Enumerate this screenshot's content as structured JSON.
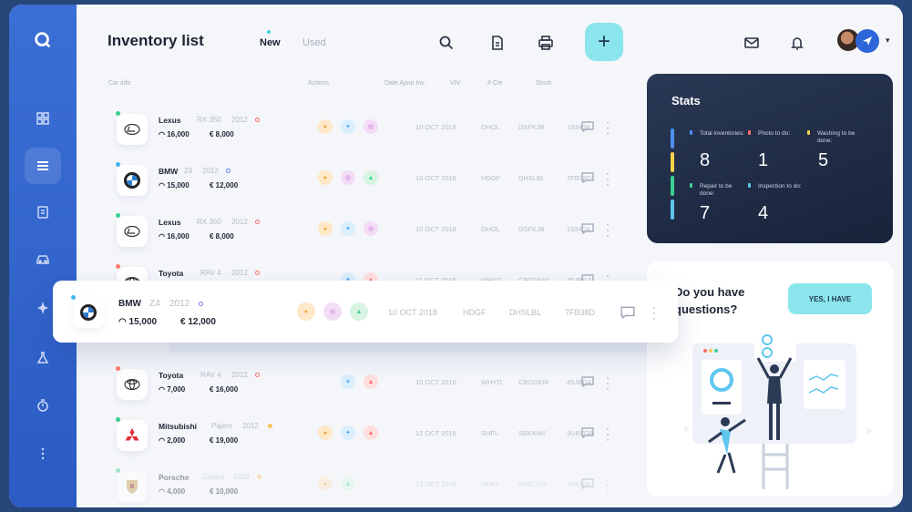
{
  "header": {
    "title": "Inventory list",
    "tabs": [
      {
        "label": "New"
      },
      {
        "label": "Used"
      }
    ],
    "tools": [
      "search-icon",
      "document-icon",
      "printer-icon",
      "mail-icon",
      "bell-icon"
    ],
    "add_label": "+"
  },
  "columns": {
    "car_info": "Car info",
    "actions": "Actions",
    "date": "Date Ajout Inv.",
    "vin": "VIV",
    "cle": "# Cle",
    "stock": "Stock"
  },
  "rows": [
    {
      "make": "Lexus",
      "model": "RX 350",
      "year": "2012",
      "km": "16,000",
      "price": "€ 8,000",
      "date": "10 OCT 2018",
      "vin": "DHOL",
      "cle": "DSFKJB",
      "stock": "19340A"
    },
    {
      "make": "BMW",
      "model": "Z4",
      "year": "2012",
      "km": "15,000",
      "price": "€ 12,000",
      "date": "10 OCT 2018",
      "vin": "HDGF",
      "cle": "DHSLBL",
      "stock": "7FB38D"
    },
    {
      "make": "Lexus",
      "model": "RX 350",
      "year": "2012",
      "km": "16,000",
      "price": "€ 8,000",
      "date": "10 OCT 2018",
      "vin": "DHOL",
      "cle": "DSFKJB",
      "stock": "19340A"
    },
    {
      "make": "Toyota",
      "model": "RAV 4",
      "year": "2012",
      "km": "",
      "price": "",
      "date": "11 OCT 2018",
      "vin": "WHYD",
      "cle": "CBGDKM",
      "stock": "45JBG4"
    },
    {
      "make": "Toyota",
      "model": "RAV 4",
      "year": "2012",
      "km": "7,000",
      "price": "€ 16,000",
      "date": "10 OCT 2018",
      "vin": "WHYD",
      "cle": "CBGDKM",
      "stock": "45JBG4"
    },
    {
      "make": "Mitsubishi",
      "model": "Pajero",
      "year": "2012",
      "km": "2,000",
      "price": "€ 19,000",
      "date": "12 OCT 2018",
      "vin": "SHFL",
      "cle": "SBKKNV",
      "stock": "3U6VG8"
    },
    {
      "make": "Porsche",
      "model": "Carera",
      "year": "2018",
      "km": "4,000",
      "price": "€ 10,000",
      "date": "13 OCT 2018",
      "vin": "DHFJ",
      "cle": "WGCLVK",
      "stock": "384JKK"
    }
  ],
  "floating_row": {
    "make": "BMW",
    "model": "Z4",
    "year": "2012",
    "km": "15,000",
    "price": "€ 12,000",
    "date": "10 OCT 2018",
    "vin": "HDGF",
    "cle": "DHSLBL",
    "stock": "7FB38D"
  },
  "stats": {
    "title": "Stats",
    "items": [
      {
        "label": "Total inventories:",
        "value": "8"
      },
      {
        "label": "Photo to do:",
        "value": "1"
      },
      {
        "label": "Washing to be done:",
        "value": "5"
      },
      {
        "label": "Repair to be done:",
        "value": "7"
      },
      {
        "label": "Inspection to do:",
        "value": "4"
      }
    ]
  },
  "help": {
    "question": "Do you have questions?",
    "button": "YES, I HAVE"
  },
  "colors": {
    "accent": "#8ae6ec",
    "sidebar": "#3b6fd6",
    "stats_bg": "#1f2b44"
  }
}
